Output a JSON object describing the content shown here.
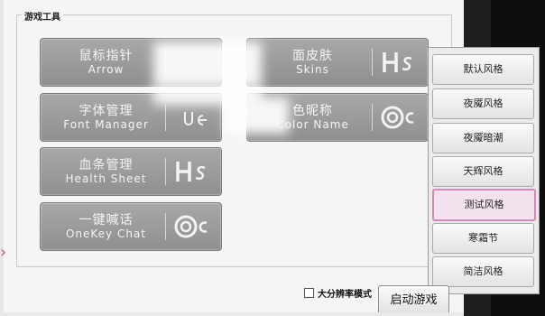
{
  "group_title": "游戏工具",
  "tools": [
    {
      "cn": "鼠标指针",
      "en": "Arrow",
      "icon": "partial-icon"
    },
    {
      "cn": "字体管理",
      "en": "Font Manager",
      "icon": "ue-icon"
    },
    {
      "cn": "血条管理",
      "en": "Health Sheet",
      "icon": "hs-icon"
    },
    {
      "cn": "一键喊话",
      "en": "OneKey Chat",
      "icon": "oc-icon"
    },
    {
      "cn": "面皮肤",
      "en": "Skins",
      "icon": "hs-icon"
    },
    {
      "cn": "色昵称",
      "en": "Color Name",
      "icon": "oc-icon"
    }
  ],
  "style_menu": {
    "items": [
      "默认风格",
      "夜魇风格",
      "夜魇暗潮",
      "天辉风格",
      "测试风格",
      "寒霜节",
      "简洁风格"
    ],
    "selected": "测试风格"
  },
  "hires_label": "大分辨率模式",
  "hires_checked": false,
  "launch_label": "启动游戏",
  "colors": {
    "button_gray": "#9b9b9b",
    "accent_pink": "#d887b8",
    "panel_bg": "#f5f5f5"
  }
}
